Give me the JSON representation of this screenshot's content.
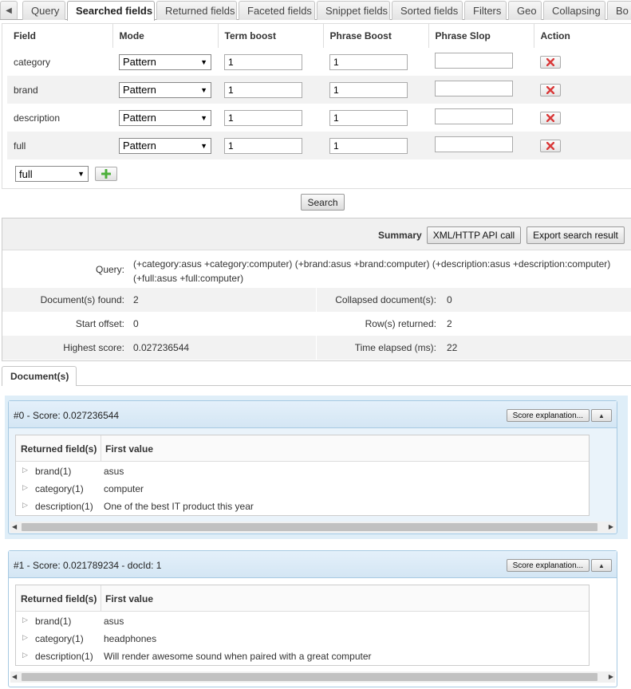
{
  "tabs": [
    {
      "label": "Query",
      "active": false
    },
    {
      "label": "Searched fields",
      "active": true
    },
    {
      "label": "Returned fields",
      "active": false
    },
    {
      "label": "Faceted fields",
      "active": false
    },
    {
      "label": "Snippet fields",
      "active": false
    },
    {
      "label": "Sorted fields",
      "active": false
    },
    {
      "label": "Filters",
      "active": false
    },
    {
      "label": "Geo",
      "active": false
    },
    {
      "label": "Collapsing",
      "active": false
    },
    {
      "label": "Bo",
      "active": false
    }
  ],
  "searched_fields": {
    "columns": [
      "Field",
      "Mode",
      "Term boost",
      "Phrase Boost",
      "Phrase Slop",
      "Action"
    ],
    "rows": [
      {
        "field": "category",
        "mode": "Pattern",
        "term_boost": "1",
        "phrase_boost": "1",
        "phrase_slop": ""
      },
      {
        "field": "brand",
        "mode": "Pattern",
        "term_boost": "1",
        "phrase_boost": "1",
        "phrase_slop": ""
      },
      {
        "field": "description",
        "mode": "Pattern",
        "term_boost": "1",
        "phrase_boost": "1",
        "phrase_slop": ""
      },
      {
        "field": "full",
        "mode": "Pattern",
        "term_boost": "1",
        "phrase_boost": "1",
        "phrase_slop": ""
      }
    ],
    "new_field_select": "full"
  },
  "search_button": "Search",
  "summary": {
    "label": "Summary",
    "xml_button": "XML/HTTP API call",
    "export_button": "Export search result",
    "query_label": "Query:",
    "query_value": "(+category:asus +category:computer) (+brand:asus +brand:computer) (+description:asus +description:computer) (+full:asus +full:computer)",
    "docs_found_label": "Document(s) found:",
    "docs_found": "2",
    "collapsed_label": "Collapsed document(s):",
    "collapsed": "0",
    "start_offset_label": "Start offset:",
    "start_offset": "0",
    "rows_returned_label": "Row(s) returned:",
    "rows_returned": "2",
    "highest_score_label": "Highest score:",
    "highest_score": "0.027236544",
    "time_elapsed_label": "Time elapsed (ms):",
    "time_elapsed": "22"
  },
  "documents_tab": "Document(s)",
  "documents": [
    {
      "title": "#0 - Score: 0.027236544",
      "score_button": "Score explanation...",
      "col1": "Returned field(s)",
      "col2": "First value",
      "fields": [
        {
          "name": "brand(1)",
          "value": "asus"
        },
        {
          "name": "category(1)",
          "value": "computer"
        },
        {
          "name": "description(1)",
          "value": "One of the best IT product this year"
        }
      ]
    },
    {
      "title": "#1 - Score: 0.021789234 - docId: 1",
      "score_button": "Score explanation...",
      "col1": "Returned field(s)",
      "col2": "First value",
      "fields": [
        {
          "name": "brand(1)",
          "value": "asus"
        },
        {
          "name": "category(1)",
          "value": "headphones"
        },
        {
          "name": "description(1)",
          "value": "Will render awesome sound when paired with a great computer"
        }
      ]
    }
  ],
  "icons": {
    "delete": "red-x-icon",
    "add": "green-plus-icon",
    "collapse": "triangle-up-icon",
    "expand_row": "triangle-right-icon"
  },
  "colors": {
    "delete_red": "#d93a3a",
    "add_green": "#4caf3a",
    "card_border": "#a6c9e2",
    "card_header": "#d4e6f4"
  }
}
